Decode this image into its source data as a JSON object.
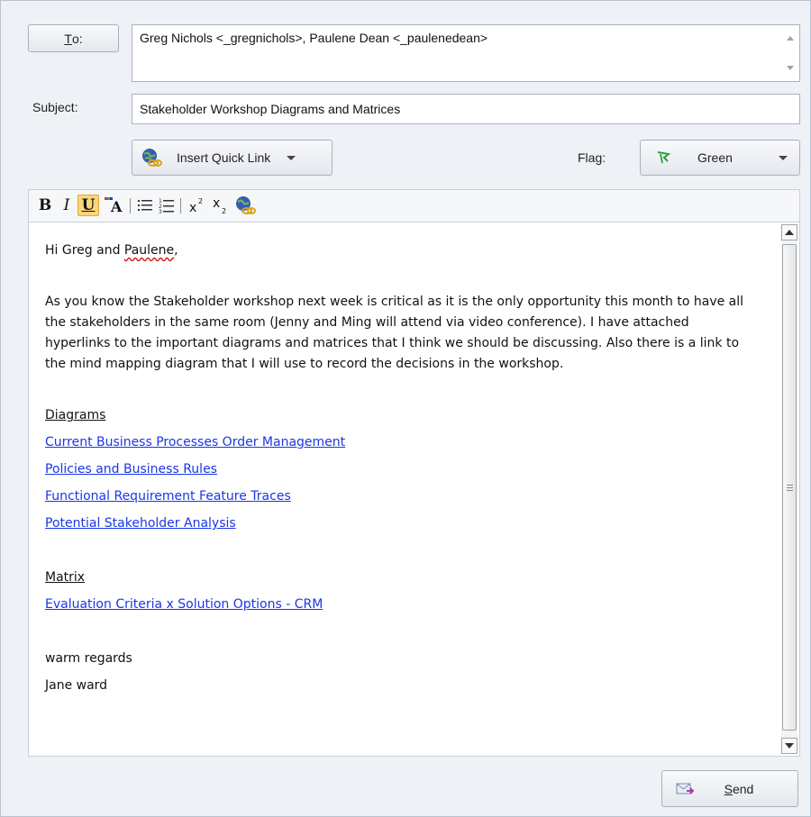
{
  "compose": {
    "to_button": {
      "label_prefix": "",
      "label_accel": "T",
      "label_rest": "o:"
    },
    "to_value": "Greg Nichols <_gregnichols>, Paulene Dean <_paulenedean>",
    "subject_label": "Subject:",
    "subject_value": "Stakeholder Workshop Diagrams and Matrices",
    "insert_quick_link_label": "Insert Quick Link",
    "flag_label": "Flag:",
    "flag_value": "Green",
    "flag_color": "#2e9e3a"
  },
  "toolbar": {
    "bold": "B",
    "italic": "I",
    "underline": "U",
    "icons": [
      "bold-icon",
      "italic-icon",
      "underline-icon",
      "font-color-icon",
      "bullet-list-icon",
      "numbered-list-icon",
      "superscript-icon",
      "subscript-icon",
      "insert-link-icon"
    ]
  },
  "body": {
    "greeting_prefix": "Hi Greg and ",
    "greeting_name": "Paulene",
    "greeting_suffix": ",",
    "paragraph": "As you know the Stakeholder workshop next week is critical as it is the only opportunity this month to have all the stakeholders in the same room (Jenny and Ming will attend via video conference). I have attached hyperlinks to the important diagrams and matrices that I think we should be discussing. Also there is a link to the mind mapping diagram that I will use to record the decisions in the workshop.",
    "diagrams_heading": "Diagrams",
    "diagram_links": [
      "Current Business Processes Order Management",
      "Policies and Business Rules",
      "Functional Requirement Feature Traces",
      "Potential Stakeholder Analysis"
    ],
    "matrix_heading": "Matrix",
    "matrix_links": [
      "Evaluation Criteria x Solution Options - CRM"
    ],
    "closing": "warm regards",
    "signature": "Jane ward"
  },
  "send": {
    "label_accel": "S",
    "label_rest": "end"
  },
  "colors": {
    "link": "#1a37e6",
    "highlight": "#f9d77a"
  }
}
